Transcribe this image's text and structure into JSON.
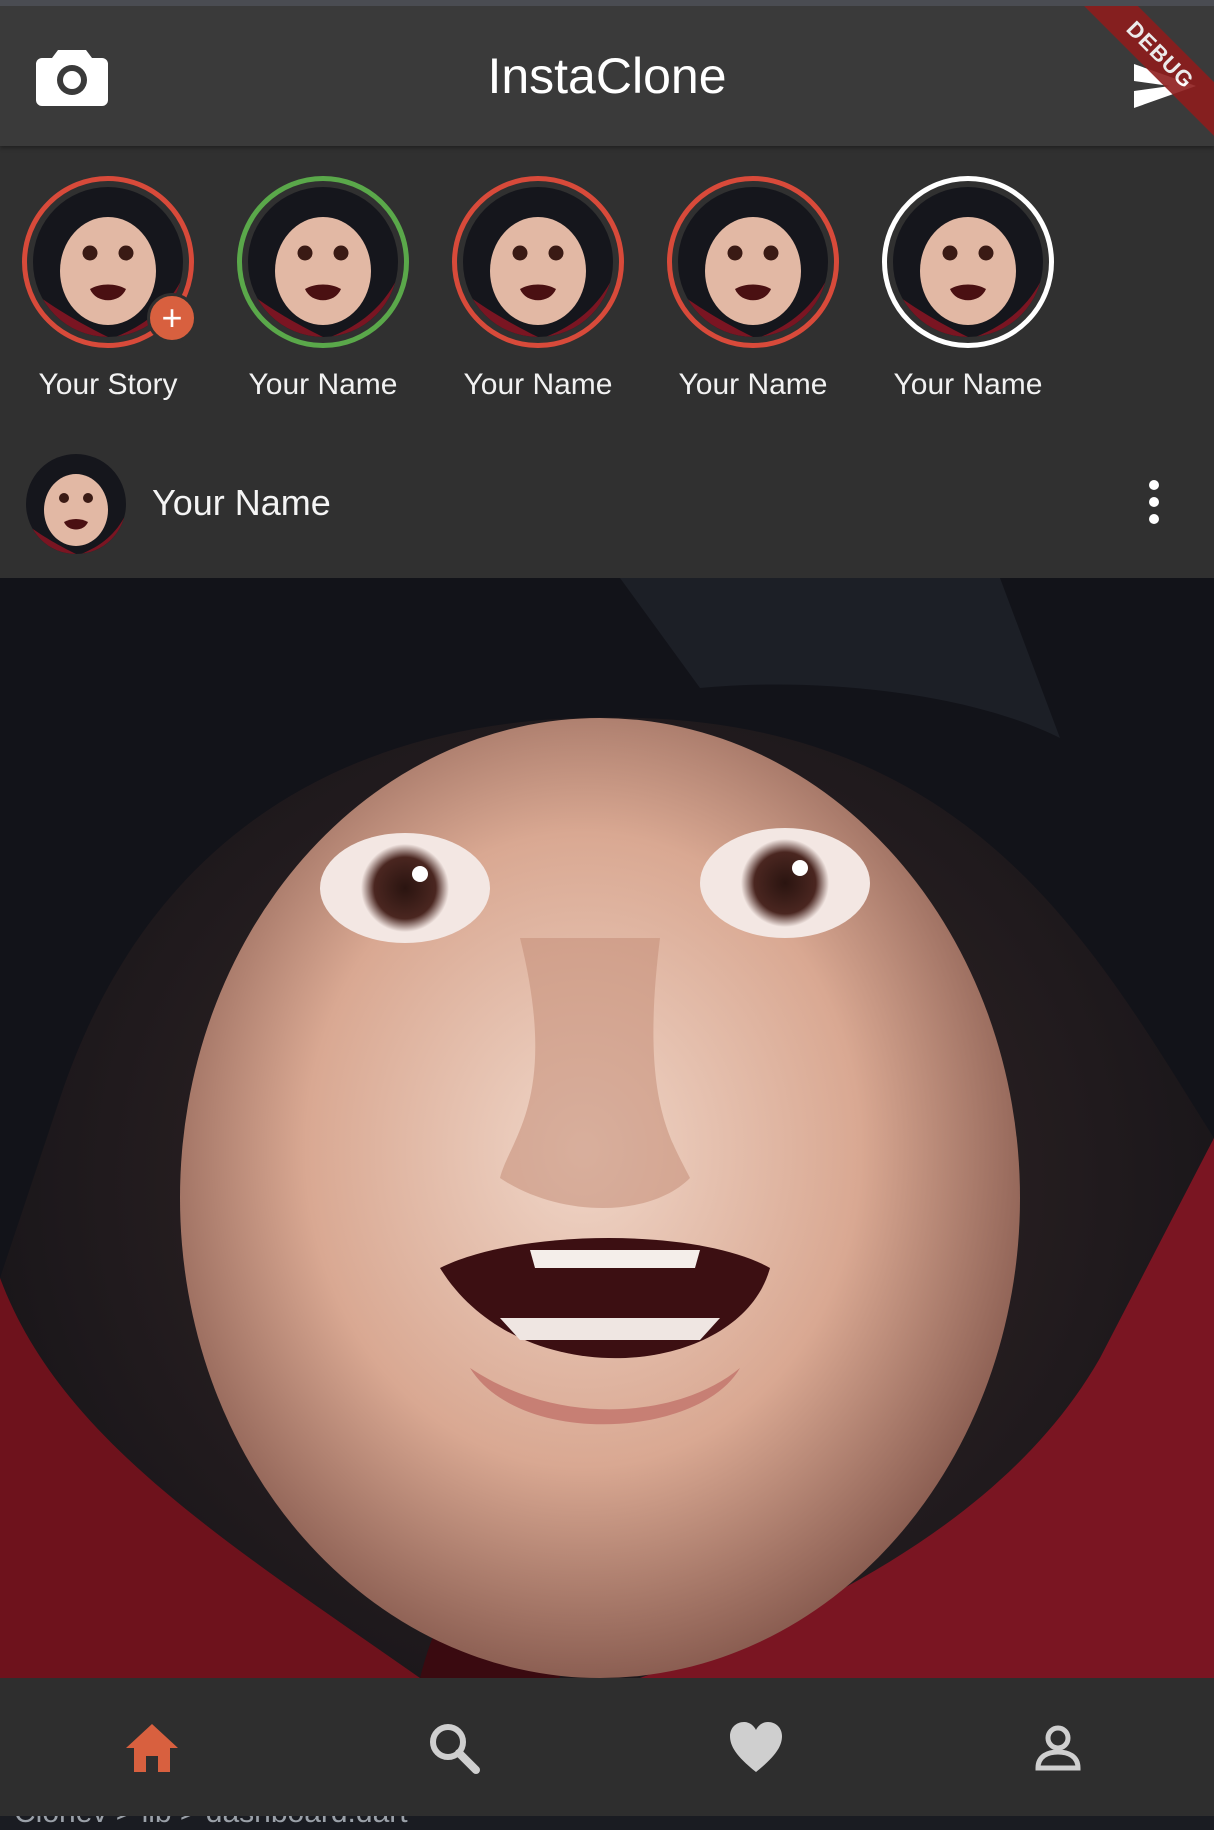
{
  "app": {
    "title": "InstaClone",
    "debug_banner": "DEBUG"
  },
  "colors": {
    "appbar": "#3a3a3a",
    "background": "#303030",
    "story_ring_unseen": "#d84a3a",
    "story_ring_live": "#5aa84a",
    "story_ring_seen": "#ffffff",
    "accent": "#d8603f"
  },
  "stories": [
    {
      "label": "Your Story",
      "ring": "red",
      "has_add_badge": true
    },
    {
      "label": "Your Name",
      "ring": "green"
    },
    {
      "label": "Your Name",
      "ring": "red"
    },
    {
      "label": "Your Name",
      "ring": "red"
    },
    {
      "label": "Your Name",
      "ring": "white"
    }
  ],
  "add_badge": "+",
  "post": {
    "username": "Your Name"
  },
  "bottom_nav": [
    {
      "icon": "home-icon",
      "active": true
    },
    {
      "icon": "search-icon",
      "active": false
    },
    {
      "icon": "heart-icon",
      "active": false
    },
    {
      "icon": "person-icon",
      "active": false
    }
  ],
  "behind_window_text": "Clonev > lib > dashboard.dart"
}
